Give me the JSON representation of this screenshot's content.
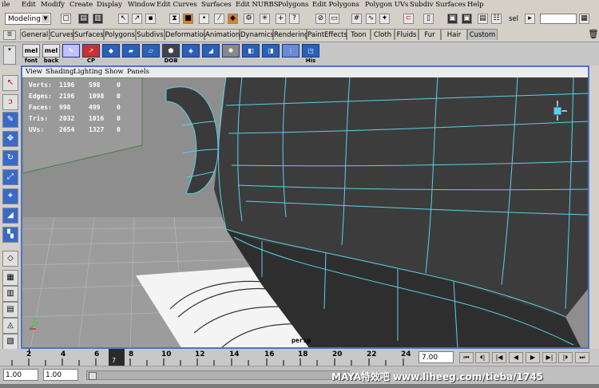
{
  "menubar": {
    "items": [
      "ile",
      "Edit",
      "Modify",
      "Create",
      "Display",
      "Window",
      "Edit Curves",
      "Surfaces",
      "Edit NURBS",
      "Polygons",
      "Edit Polygons",
      "Polygon UVs",
      "Subdiv Surfaces",
      "Help"
    ]
  },
  "statusline": {
    "mode": "Modeling",
    "sel_label": "sel"
  },
  "shelf": {
    "tabs": [
      "General",
      "Curves",
      "Surfaces",
      "Polygons",
      "Subdivs",
      "Deformation",
      "Animation",
      "Dynamics",
      "Rendering",
      "PaintEffects",
      "Toon",
      "Cloth",
      "Fluids",
      "Fur",
      "Hair",
      "Custom"
    ],
    "active_tab": "Custom",
    "buttons": [
      {
        "icon": "mel",
        "label": "font"
      },
      {
        "icon": "mel",
        "label": "back"
      },
      {
        "icon": "",
        "label": ""
      },
      {
        "icon": "",
        "label": "CP"
      },
      {
        "icon": "",
        "label": ""
      },
      {
        "icon": "",
        "label": ""
      },
      {
        "icon": "",
        "label": ""
      },
      {
        "icon": "",
        "label": "DOB"
      },
      {
        "icon": "",
        "label": ""
      },
      {
        "icon": "",
        "label": ""
      },
      {
        "icon": "",
        "label": ""
      },
      {
        "icon": "",
        "label": ""
      },
      {
        "icon": "",
        "label": ""
      },
      {
        "icon": "",
        "label": ""
      },
      {
        "icon": "",
        "label": "His"
      }
    ]
  },
  "viewport": {
    "menu": [
      "View",
      "Shading",
      "Lighting",
      "Show",
      "Panels"
    ],
    "camera": "persp",
    "hud": [
      {
        "label": "Verts:",
        "a": "1196",
        "b": "598",
        "c": "0"
      },
      {
        "label": "Edges:",
        "a": "2196",
        "b": "1098",
        "c": "0"
      },
      {
        "label": "Faces:",
        "a": "998",
        "b": "499",
        "c": "0"
      },
      {
        "label": "Tris:",
        "a": "2032",
        "b": "1016",
        "c": "0"
      },
      {
        "label": "UVs:",
        "a": "2654",
        "b": "1327",
        "c": "0"
      }
    ],
    "axis_label": "Z"
  },
  "timeline": {
    "ticks": [
      "2",
      "4",
      "6",
      "8",
      "10",
      "12",
      "14",
      "16",
      "18",
      "20",
      "22",
      "24"
    ],
    "current_frame": "7",
    "current_frame_field": "7.00"
  },
  "range": {
    "start": "1.00",
    "start2": "1.00",
    "watermark": "MAYA特效吧  www.liheeg.com/tieba/1745"
  },
  "colors": {
    "viewport_bg": "#8a8a8a",
    "floor": "#9a9a9a",
    "model": "#3c3c3c",
    "wire": "#5ad0e8",
    "selection_border": "#4a74c8"
  }
}
